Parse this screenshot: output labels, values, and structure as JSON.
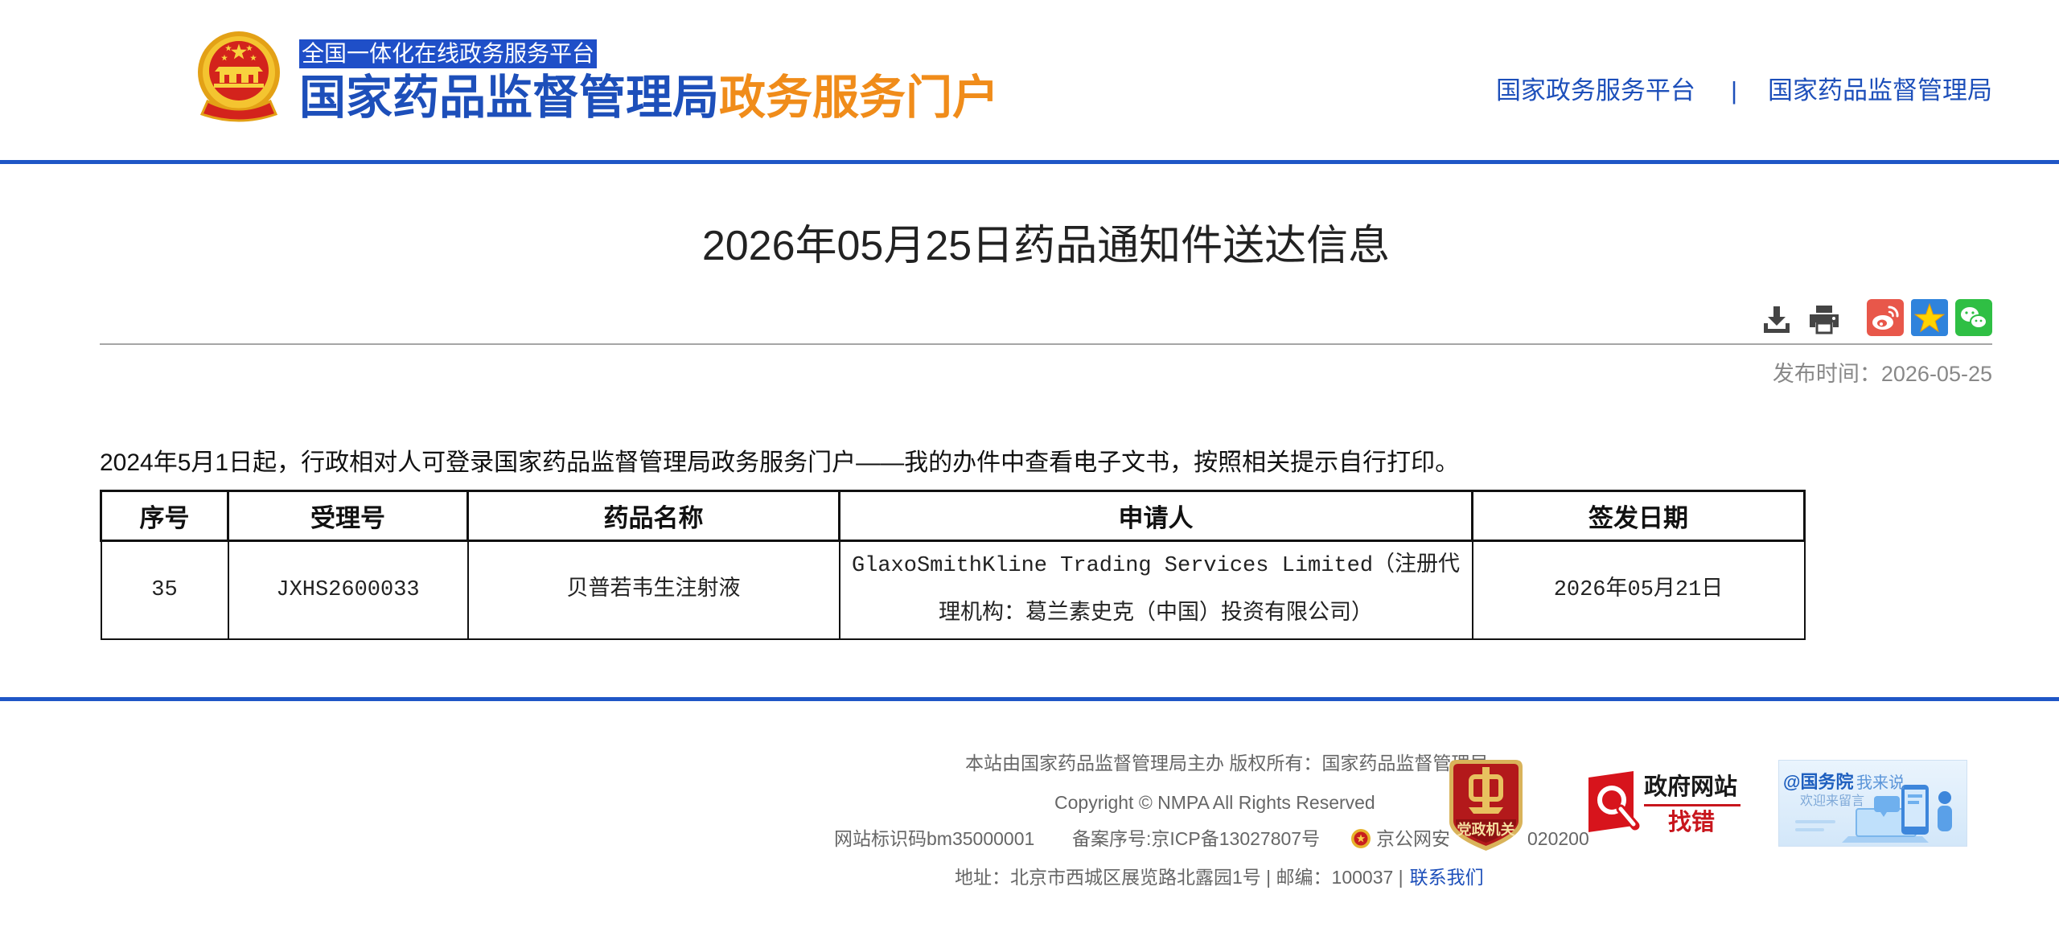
{
  "colors": {
    "brand_blue": "#1d4fba",
    "accent_orange": "#f08c1a",
    "rule_blue": "#1f56c6",
    "text_dark": "#222222",
    "text_muted": "#888888",
    "footer_text": "#666666",
    "badge_red": "#c8161d"
  },
  "header": {
    "logo_icon": "national-emblem-icon",
    "platform_label": "全国一体化在线政务服务平台",
    "title_main": "国家药品监督管理局",
    "title_accent": "政务服务门户",
    "nav": [
      {
        "label": "国家政务服务平台"
      },
      {
        "label": "国家药品监督管理局"
      }
    ],
    "nav_separator": "|"
  },
  "article": {
    "title": "2026年05月25日药品通知件送达信息",
    "tools": [
      "download-icon",
      "print-icon",
      "weibo-icon",
      "qzone-icon",
      "wechat-icon"
    ],
    "publish_label": "发布时间：",
    "publish_date": "2026-05-25",
    "notice": "2024年5月1日起，行政相对人可登录国家药品监督管理局政务服务门户——我的办件中查看电子文书，按照相关提示自行打印。",
    "table": {
      "headers": [
        "序号",
        "受理号",
        "药品名称",
        "申请人",
        "签发日期"
      ],
      "rows": [
        [
          "35",
          "JXHS2600033",
          "贝普若韦生注射液",
          "GlaxoSmithKline Trading Services Limited（注册代理机构：葛兰素史克（中国）投资有限公司）",
          "2026年05月21日"
        ]
      ]
    }
  },
  "footer": {
    "sponsor": "本站由国家药品监督管理局主办 版权所有：国家药品监督管理局",
    "copyright": "Copyright © NMPA All Rights Reserved",
    "site_id": "网站标识码bm35000001",
    "icp": "备案序号:京ICP备13027807号",
    "police_icon": "police-emblem-icon",
    "police_prefix": "京公网安",
    "police_suffix": "020200",
    "address": "地址：北京市西城区展览路北露园1号 | 邮编：100037 |",
    "contact": "联系我们",
    "badges": {
      "party_gov": "党政机关",
      "gov_site": "政府网站",
      "find_error": "找错",
      "state_council": "@国务院",
      "i_say": "我来说",
      "welcome": "欢迎来留言"
    }
  }
}
